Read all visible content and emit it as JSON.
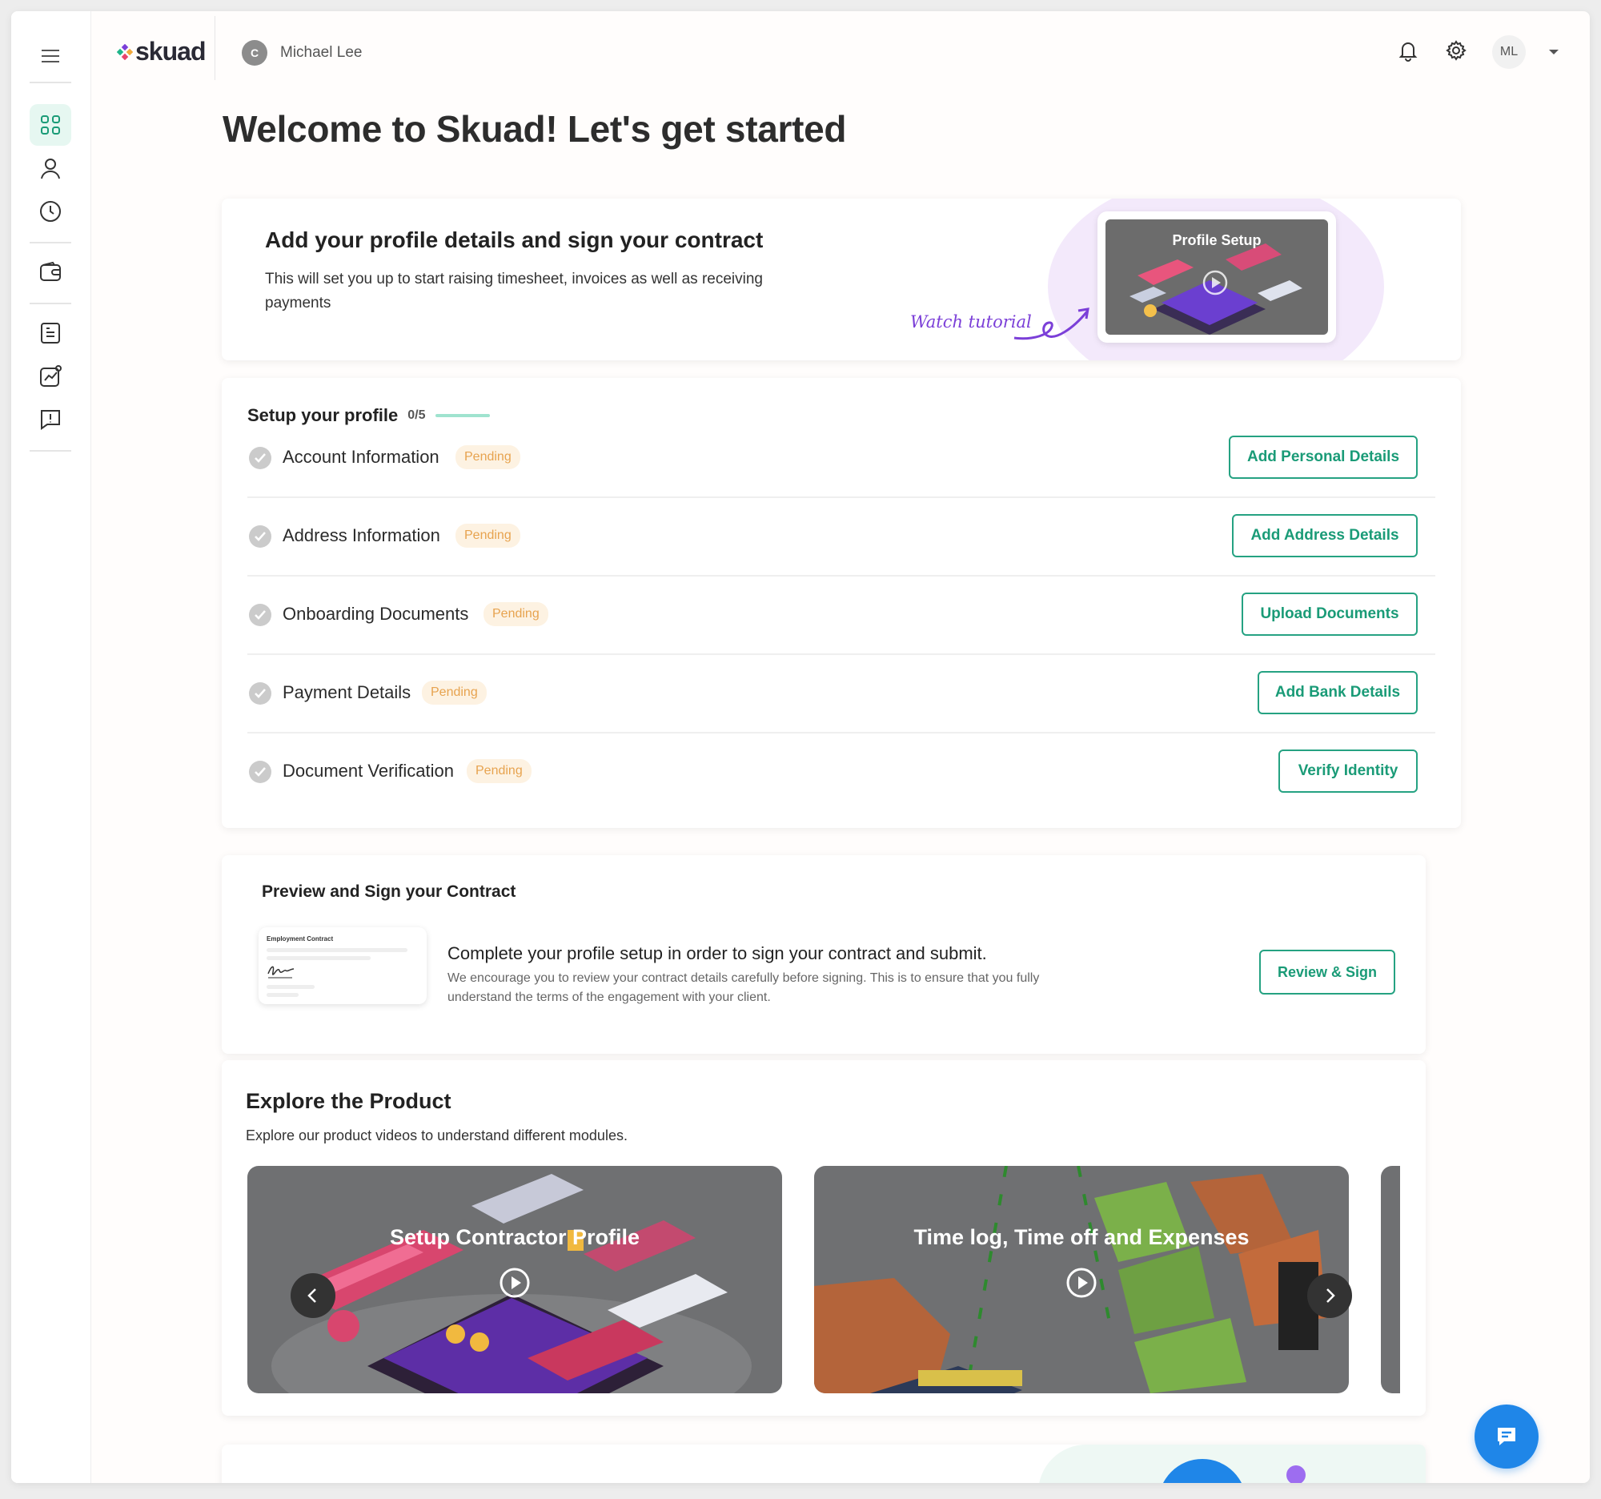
{
  "header": {
    "logo_text": "skuad",
    "company_initial": "C",
    "company_name": "Michael Lee",
    "user_initials": "ML"
  },
  "sidebar": {
    "items": [
      {
        "icon": "dashboard-icon",
        "active": true
      },
      {
        "icon": "user-icon",
        "active": false
      },
      {
        "icon": "clock-icon",
        "active": false
      },
      {
        "icon": "wallet-icon",
        "active": false
      },
      {
        "icon": "document-icon",
        "active": false
      },
      {
        "icon": "analytics-icon",
        "active": false
      },
      {
        "icon": "feedback-icon",
        "active": false
      }
    ]
  },
  "welcome_title": "Welcome to Skuad! Let's get started",
  "intro_card": {
    "title": "Add your profile details and sign your contract",
    "description": "This will set you up to start raising timesheet, invoices as well as receiving payments",
    "watch_label": "Watch tutorial",
    "video_title": "Profile Setup"
  },
  "setup_profile": {
    "title": "Setup your profile",
    "progress": "0/5",
    "progress_fraction": 0,
    "items": [
      {
        "label": "Account Information",
        "status": "Pending",
        "action": "Add Personal Details"
      },
      {
        "label": "Address Information",
        "status": "Pending",
        "action": "Add Address Details"
      },
      {
        "label": "Onboarding Documents",
        "status": "Pending",
        "action": "Upload Documents"
      },
      {
        "label": "Payment Details",
        "status": "Pending",
        "action": "Add Bank Details"
      },
      {
        "label": "Document Verification",
        "status": "Pending",
        "action": "Verify Identity"
      }
    ]
  },
  "contract": {
    "title": "Preview and Sign your Contract",
    "doc_label": "Employment Contract",
    "main_text": "Complete your profile setup in order to sign your contract and submit.",
    "sub_text": "We encourage you to review your contract details carefully before signing. This is to ensure that you fully understand the terms of the engagement with your client.",
    "button": "Review & Sign"
  },
  "explore": {
    "title": "Explore the Product",
    "subtitle": "Explore our product videos to understand different modules.",
    "videos": [
      {
        "title": "Setup Contractor Profile"
      },
      {
        "title": "Time log, Time off and Expenses"
      }
    ]
  },
  "colors": {
    "accent": "#1a9b77",
    "pending_text": "#e7a34f",
    "pending_bg": "#fdf2e2",
    "chat_fab": "#1f86e8",
    "watch_tutorial": "#7b3fd8"
  }
}
